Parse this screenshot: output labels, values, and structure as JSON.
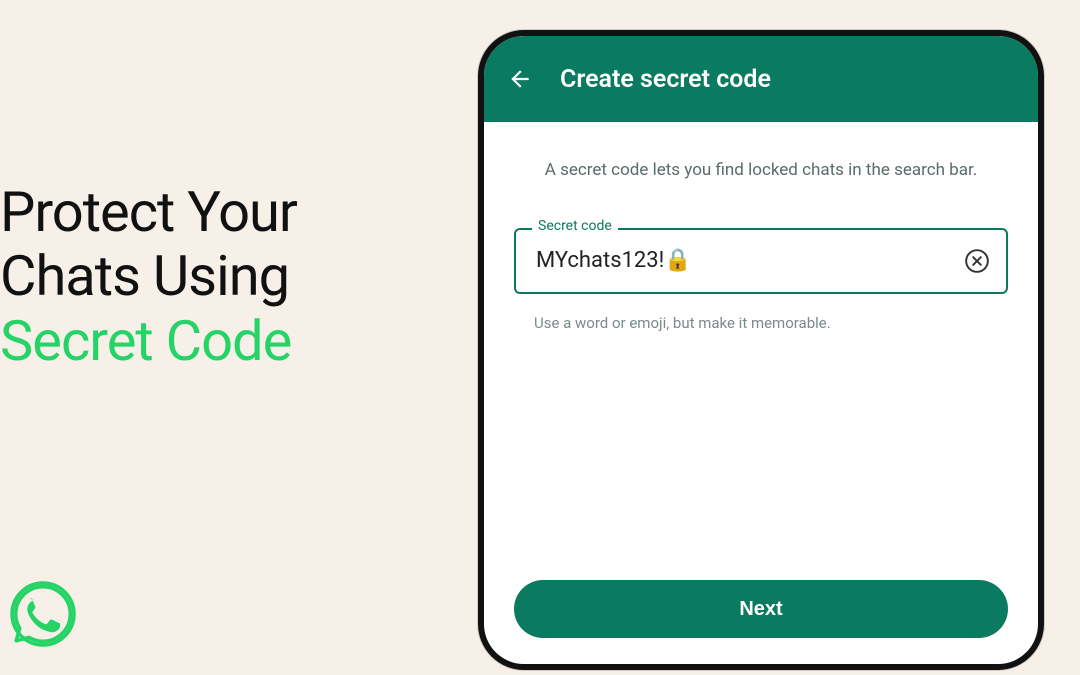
{
  "headline": {
    "line1": "Protect Your",
    "line2": "Chats Using",
    "line3_accent": "Secret Code"
  },
  "phone": {
    "appbar": {
      "title": "Create secret code"
    },
    "description": "A secret code lets you find locked chats in the search bar.",
    "field": {
      "label": "Secret code",
      "value": "MYchats123!🔒"
    },
    "hint": "Use a word or emoji, but make it memorable.",
    "next_label": "Next"
  }
}
